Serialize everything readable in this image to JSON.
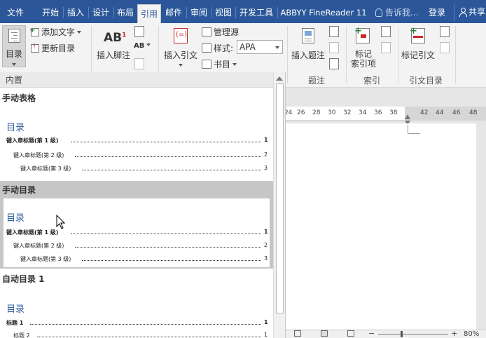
{
  "tabs": [
    {
      "label": "文件",
      "active": false
    },
    {
      "label": "开始",
      "active": false
    },
    {
      "label": "插入",
      "active": false
    },
    {
      "label": "设计",
      "active": false
    },
    {
      "label": "布局",
      "active": false
    },
    {
      "label": "引用",
      "active": true
    },
    {
      "label": "邮件",
      "active": false
    },
    {
      "label": "审阅",
      "active": false
    },
    {
      "label": "视图",
      "active": false
    },
    {
      "label": "开发工具",
      "active": false
    },
    {
      "label": "ABBYY FineReader 11",
      "active": false
    }
  ],
  "tellme": "告诉我...",
  "login": "登录",
  "share": "共享",
  "ribbon": {
    "toc_button": "目录",
    "add_text": "添加文字",
    "update_toc": "更新目录",
    "insert_footnote": "插入脚注",
    "footnote_ab": "AB",
    "footnote_sup": "1",
    "footnote_next": "AB",
    "insert_citation": "插入引文",
    "manage_sources": "管理源",
    "style_label": "样式:",
    "style_value": "APA",
    "bibliography": "书目",
    "insert_caption": "插入题注",
    "mark_entry_l1": "标记",
    "mark_entry_l2": "索引项",
    "mark_citation": "标记引文",
    "groups": {
      "caption": "题注",
      "index": "索引",
      "toa": "引文目录"
    }
  },
  "ruler_numbers": [
    "24",
    "26",
    "28",
    "30",
    "32",
    "34",
    "36",
    "38",
    "42",
    "44",
    "46",
    "48"
  ],
  "status": {
    "zoom": "80%"
  },
  "gallery": {
    "header": "内置",
    "entries": [
      {
        "title": "手动表格",
        "toc_heading": "目录",
        "lines": [
          {
            "text": "键入章标题(第 1 级)",
            "page": "1"
          },
          {
            "text": "键入章标题(第 2 级)",
            "page": "2"
          },
          {
            "text": "键入章标题(第 3 级)",
            "page": "3"
          }
        ]
      },
      {
        "title": "手动目录",
        "toc_heading": "目录",
        "lines": [
          {
            "text": "键入章标题(第 1 级)",
            "page": "1"
          },
          {
            "text": "键入章标题(第 2 级)",
            "page": "2"
          },
          {
            "text": "键入章标题(第 3 级)",
            "page": "3"
          }
        ]
      },
      {
        "title": "自动目录 1",
        "toc_heading": "目录",
        "lines": [
          {
            "text": "标题 1",
            "page": "1"
          },
          {
            "text": "标题 2",
            "page": "1"
          }
        ]
      }
    ]
  },
  "colors": {
    "tab_bar": "#2b579a",
    "ribbon_bg": "#f3f3f3",
    "toc_heading": "#2e5d9e",
    "selected_entry": "#c6c6c6"
  }
}
